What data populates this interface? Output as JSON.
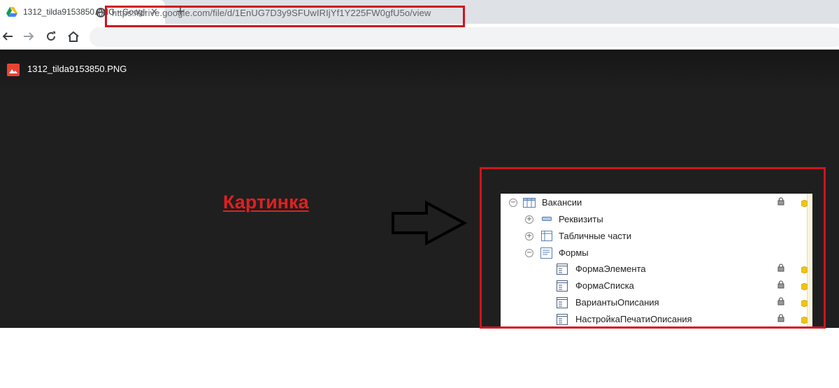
{
  "browser": {
    "tab_title": "1312_tilda9153850.PNG - Google",
    "tab_close": "✕",
    "new_tab": "+",
    "url": "https://drive.google.com/file/d/1EnUG7D3y9SFUwIRIjYf1Y225FW0gfU5o/view"
  },
  "viewer": {
    "file_name": "1312_tilda9153850.PNG"
  },
  "annotation": {
    "label": "Картинка",
    "accent_color": "#d0141e"
  },
  "tree": {
    "root": "Вакансии",
    "items": [
      "Реквизиты",
      "Табличные части",
      "Формы"
    ],
    "forms": [
      "ФормаЭлемента",
      "ФормаСписка",
      "ВариантыОписания",
      "НастройкаПечатиОписания"
    ],
    "expand_plus": "+",
    "expand_minus": "−"
  }
}
